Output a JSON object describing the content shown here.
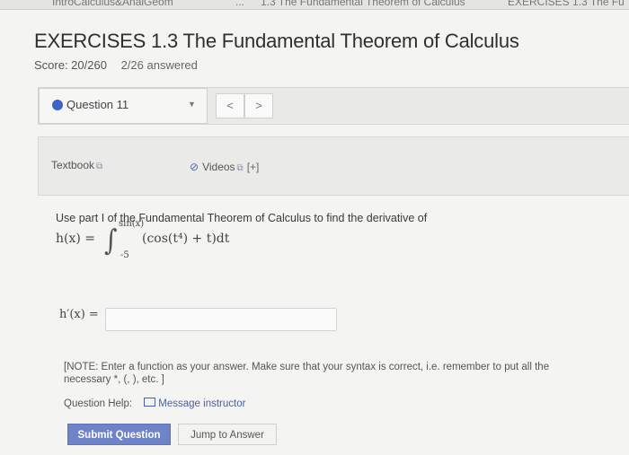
{
  "breadcrumb": {
    "course": "IntroCalculus&AnalGeom",
    "separator": "...",
    "section": "1.3 The Fundamental Theorem of Calculus",
    "current": "EXERCISES 1.3 The Fu"
  },
  "header": {
    "title": "EXERCISES 1.3 The Fundamental Theorem of Calculus",
    "score": "Score: 20/260",
    "answered": "2/26 answered"
  },
  "question_nav": {
    "selected": "Question 11",
    "prev_symbol": "<",
    "next_symbol": ">",
    "status_color": "#3d63c8"
  },
  "resources": {
    "textbook_label": "Textbook",
    "videos_label": "Videos",
    "videos_expand": "[+]"
  },
  "question": {
    "prompt": "Use part I of the Fundamental Theorem of Calculus to find the derivative of",
    "function_lhs": "h(x) =",
    "upper_limit": "sin(x)",
    "lower_limit": "-5",
    "integrand": "(cos(t⁴) + t)dt",
    "answer_label": "h′(x) =",
    "answer_value": ""
  },
  "note": {
    "line1": "[NOTE: Enter a function as your answer. Make sure that your syntax is correct, i.e. remember to put all the",
    "line2": "necessary *, (, ), etc. ]"
  },
  "help": {
    "label": "Question Help:",
    "message_link": "Message instructor"
  },
  "actions": {
    "submit_label": "Submit Question",
    "jump_label": "Jump to Answer"
  }
}
